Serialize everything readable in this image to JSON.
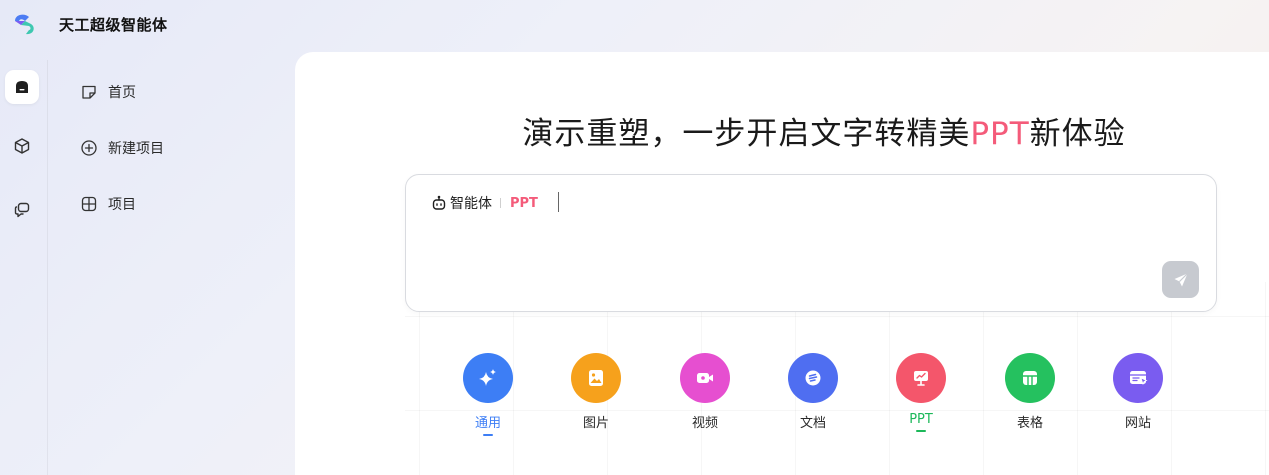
{
  "brand": {
    "name": "天工超级智能体"
  },
  "rail": {
    "items": [
      {
        "icon": "home-icon",
        "active": true
      },
      {
        "icon": "cube-icon",
        "active": false
      },
      {
        "icon": "chat-history-icon",
        "active": false
      }
    ]
  },
  "nav": {
    "items": [
      {
        "label": "首页",
        "icon": "home-outline-icon"
      },
      {
        "label": "新建项目",
        "icon": "plus-circle-icon"
      },
      {
        "label": "项目",
        "icon": "project-grid-icon"
      }
    ]
  },
  "main": {
    "headline_prefix": "演示重塑，一步开启文字转精美",
    "headline_highlight": "PPT",
    "headline_suffix": "新体验",
    "accent_color": "#f45b7a",
    "input": {
      "agent_label": "智能体",
      "agent_mode": "PPT",
      "value": "",
      "send_icon": "send-icon"
    },
    "categories": [
      {
        "label": "通用",
        "color": "#3d7ef5",
        "icon": "sparkle-icon",
        "selected": true,
        "label_color": "#3d7ef5"
      },
      {
        "label": "图片",
        "color": "#f6a11c",
        "icon": "image-icon",
        "selected": false,
        "label_color": "#2a2a2a"
      },
      {
        "label": "视频",
        "color": "#e64fd0",
        "icon": "video-icon",
        "selected": false,
        "label_color": "#2a2a2a"
      },
      {
        "label": "文档",
        "color": "#4f6ef1",
        "icon": "document-icon",
        "selected": false,
        "label_color": "#2a2a2a"
      },
      {
        "label": "PPT",
        "color": "#f4566b",
        "icon": "presentation-icon",
        "selected": true,
        "label_color": "#1db85a"
      },
      {
        "label": "表格",
        "color": "#25c15f",
        "icon": "table-icon",
        "selected": false,
        "label_color": "#2a2a2a"
      },
      {
        "label": "网站",
        "color": "#7a5cf0",
        "icon": "website-icon",
        "selected": false,
        "label_color": "#2a2a2a"
      }
    ]
  }
}
